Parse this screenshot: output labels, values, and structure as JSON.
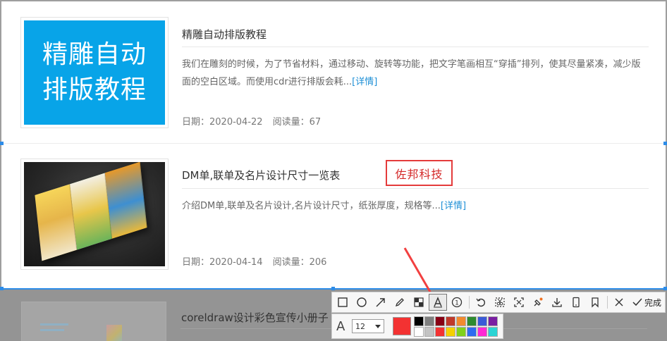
{
  "articles": [
    {
      "thumb_lines": [
        "精雕自动",
        "排版教程"
      ],
      "title": "精雕自动排版教程",
      "desc": "我们在雕刻的时候，为了节省材料，通过移动、旋转等功能，把文字笔画相互“穿插”排列，使其尽量紧凑，减少版面的空白区域。而使用cdr进行排版会耗...",
      "more": "[详情]",
      "date": "日期：2020-04-22",
      "views": "阅读量：67"
    },
    {
      "title": "DM单,联单及名片设计尺寸一览表",
      "desc": "介绍DM单,联单及名片设计,名片设计尺寸，纸张厚度，规格等...",
      "more": "[详情]",
      "date": "日期：2020-04-14",
      "views": "阅读量：206"
    },
    {
      "title": "coreldraw设计彩色宣传小册子"
    }
  ],
  "annotation": {
    "text": "佐邦科技",
    "color": "#e43b3b"
  },
  "toolbar": {
    "tools": [
      "rectangle-tool",
      "ellipse-tool",
      "arrow-tool",
      "pencil-tool",
      "mosaic-tool",
      "text-tool",
      "number-tool",
      "undo",
      "cut-tool",
      "fullscreen-tool",
      "pin-tool",
      "save",
      "phone",
      "bookmark",
      "close",
      "done"
    ],
    "active_tool": "text-tool",
    "done_label": "完成"
  },
  "text_options": {
    "font_size": "12",
    "current_color": "#f33232",
    "palette": [
      "#000000",
      "#7f7f7f",
      "#880015",
      "#c0392b",
      "#f28a2e",
      "#2e8b2e",
      "#3a5bd8",
      "#7a1fa2",
      "#17a0a0",
      "#ffffff",
      "#c3c3c3",
      "#f33232",
      "#f5d000",
      "#7fd11b",
      "#2f6bf0",
      "#ff2ad4",
      "#2ad4d4"
    ]
  }
}
